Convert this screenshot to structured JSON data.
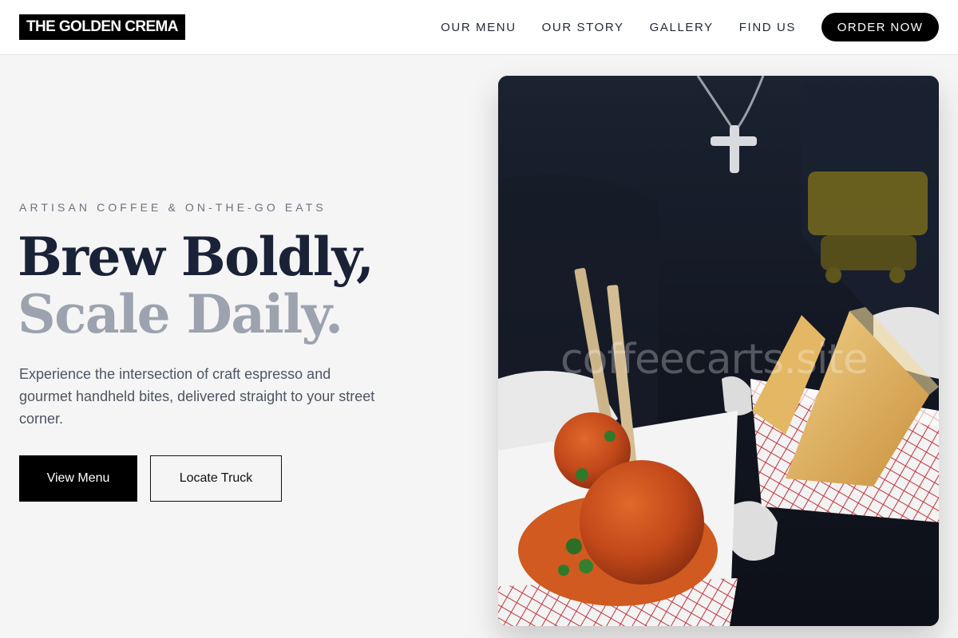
{
  "brand": {
    "name": "THE GOLDEN CREMA"
  },
  "nav": {
    "links": [
      "OUR MENU",
      "OUR STORY",
      "GALLERY",
      "FIND US"
    ],
    "cta": "ORDER NOW"
  },
  "hero": {
    "eyebrow": "ARTISAN COFFEE & ON-THE-GO EATS",
    "headline_line1": "Brew Boldly,",
    "headline_line2": "Scale Daily.",
    "lead": "Experience the intersection of craft espresso and gourmet handheld bites, delivered straight to your street corner.",
    "primary_button": "View Menu",
    "secondary_button": "Locate Truck",
    "image": {
      "alt": "Gloved hands holding meatball skewers and samosas in paper food trays",
      "watermark": "coffeecarts.site"
    }
  },
  "colors": {
    "accent": "#000000",
    "headline_dark": "#1a2238",
    "headline_light": "#9ca3af",
    "background": "#f5f5f5"
  }
}
